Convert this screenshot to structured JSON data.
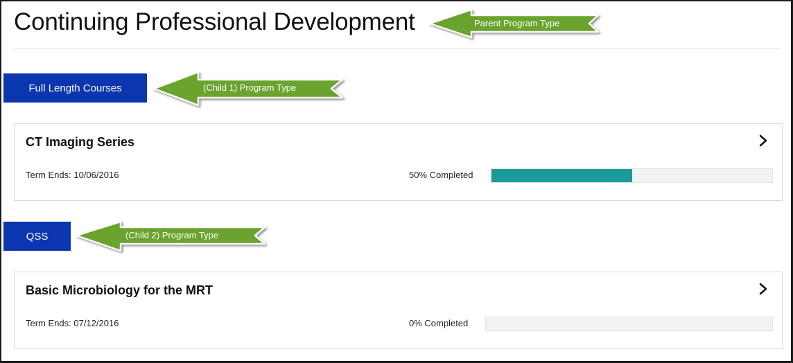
{
  "header": {
    "title": "Continuing Professional Development"
  },
  "annotations": {
    "parent": "Parent Program Type",
    "child1": "(Child 1) Program Type",
    "child2": "(Child 2) Program Type"
  },
  "program_types": [
    {
      "label": "Full Length Courses",
      "course": {
        "title": "CT Imaging Series",
        "term": "Term Ends: 10/06/2016",
        "progress_text": "50% Completed",
        "progress": 0.5
      }
    },
    {
      "label": "QSS",
      "course": {
        "title": "Basic Microbiology for the MRT",
        "term": "Term Ends: 07/12/2016",
        "progress_text": "0% Completed",
        "progress": 0
      }
    }
  ],
  "colors": {
    "button": "#0b36b0",
    "progress": "#1b9a9a",
    "callout": "#6aa32e"
  },
  "icons": {
    "course_open": "chevron-right-icon"
  }
}
